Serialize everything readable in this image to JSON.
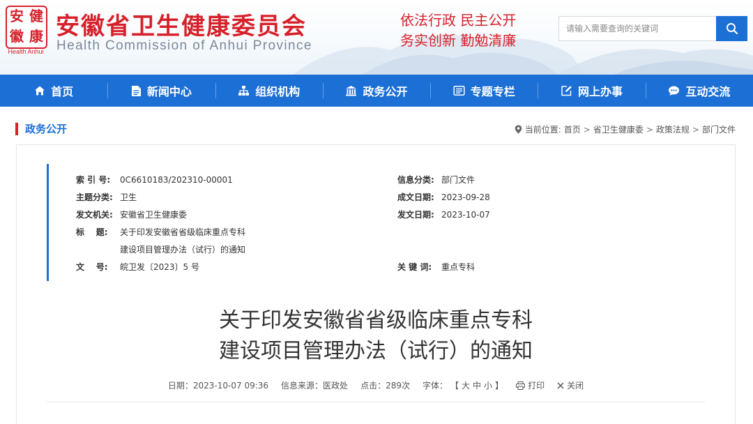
{
  "header": {
    "seal_chars": [
      "安",
      "健",
      "徽",
      "康"
    ],
    "seal_caption": "Health Anhui",
    "title": "安徽省卫生健康委员会",
    "subtitle": "Health Commission of Anhui Province",
    "slogan_line1": "依法行政  民主公开",
    "slogan_line2": "务实创新  勤勉清廉",
    "search_placeholder": "请输入需要查询的关键词",
    "search_icon": "search-icon"
  },
  "colors": {
    "brand_red": "#d7202a",
    "brand_blue": "#1b6fd5"
  },
  "nav": {
    "items": [
      {
        "label": "首页",
        "icon": "home-icon"
      },
      {
        "label": "新闻中心",
        "icon": "document-icon"
      },
      {
        "label": "组织机构",
        "icon": "org-chart-icon"
      },
      {
        "label": "政务公开",
        "icon": "building-icon"
      },
      {
        "label": "专题专栏",
        "icon": "newspaper-icon"
      },
      {
        "label": "网上办事",
        "icon": "edit-icon"
      },
      {
        "label": "互动交流",
        "icon": "chat-icon"
      }
    ]
  },
  "section": {
    "title": "政务公开",
    "location_label": "当前位置:",
    "breadcrumb": [
      "首页",
      "省卫生健康委",
      "政策法规",
      "部门文件"
    ]
  },
  "meta": {
    "index_key": "索 引 号:",
    "index_val": "0C6610183/202310-00001",
    "topic_key": "主题分类:",
    "topic_val": "卫生",
    "issuer_key": "发文机关:",
    "issuer_val": "安徽省卫生健康委",
    "title_key": "标    题:",
    "title_val_line1": "关于印发安徽省省级临床重点专科",
    "title_val_line2": "建设项目管理办法（试行）的通知",
    "docno_key": "文    号:",
    "docno_val": "皖卫发〔2023〕5 号",
    "category_key": "信息分类:",
    "category_val": "部门文件",
    "created_key": "成文日期:",
    "created_val": "2023-09-28",
    "published_key": "发文日期:",
    "published_val": "2023-10-07",
    "keywords_key": "关 键 词:",
    "keywords_val": "重点专科"
  },
  "document": {
    "title_line1": "关于印发安徽省省级临床重点专科",
    "title_line2": "建设项目管理办法（试行）的通知",
    "date": "日期：2023-10-07 09:36",
    "source": "信息来源：医政处",
    "hits": "点击：289次",
    "font_label": "字体：",
    "bracket_open": "【",
    "size_large": "大",
    "size_medium": "中",
    "size_small": "小",
    "bracket_close": "】",
    "print_label": "打印",
    "close_label": "关闭"
  }
}
